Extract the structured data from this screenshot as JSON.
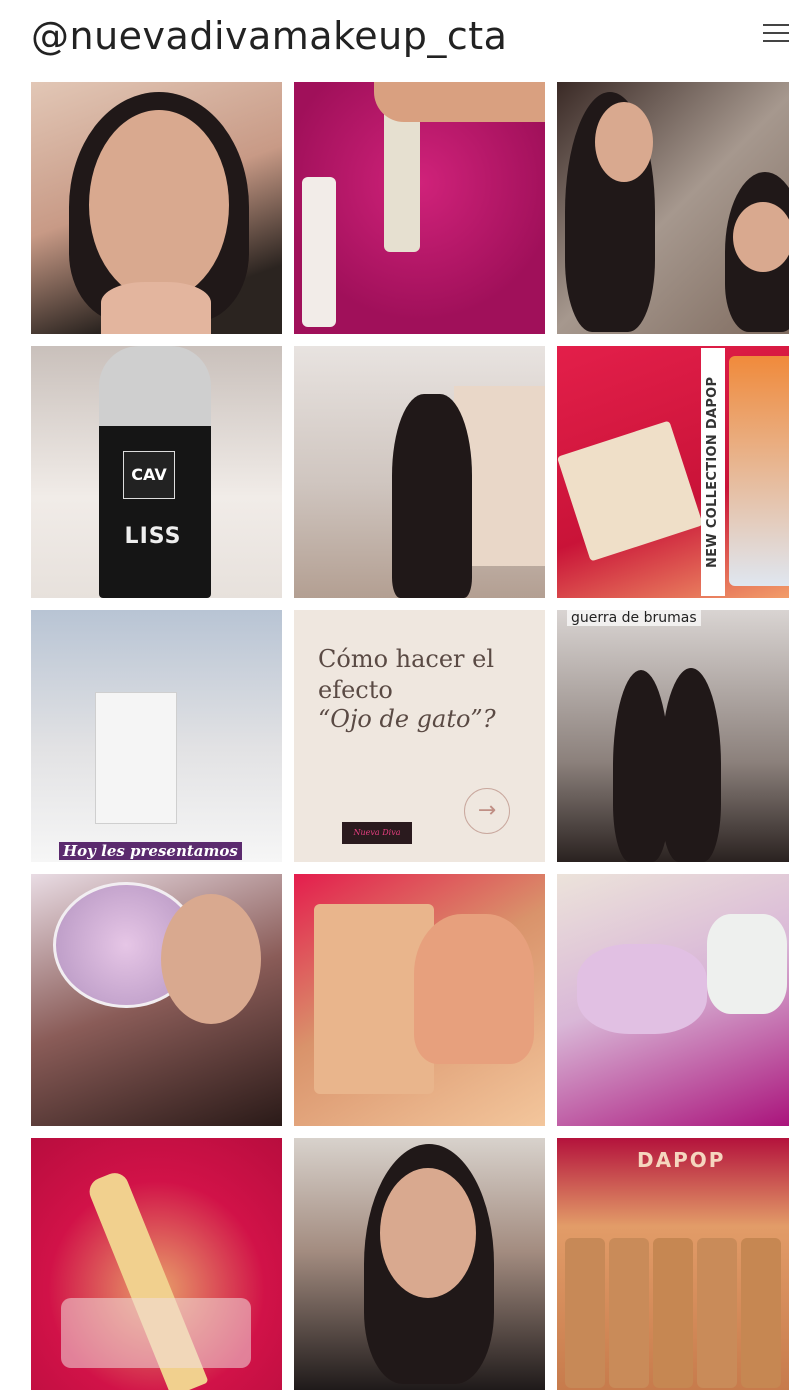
{
  "profile": {
    "handle": "@nuevadivamakeup_cta",
    "menu_icon": "hamburger-menu-icon"
  },
  "tiles": [
    {
      "id": 1,
      "kind": "photo",
      "subject": "woman applying lip product"
    },
    {
      "id": 2,
      "kind": "photo",
      "subject": "spray bottles on pink background"
    },
    {
      "id": 3,
      "kind": "photo",
      "subject": "two women in store"
    },
    {
      "id": 4,
      "kind": "photo",
      "subject": "CAV Max Liss bottle",
      "label_top": "CAV",
      "label_big": "LISS"
    },
    {
      "id": 5,
      "kind": "photo",
      "subject": "woman walking in store aisle"
    },
    {
      "id": 6,
      "kind": "photo",
      "subject": "eyeshadow palette",
      "vertical_text": "NEW COLLECTION DAPOP"
    },
    {
      "id": 7,
      "kind": "photo",
      "subject": "skincare box on counter",
      "caption": "Hoy les presentamos"
    },
    {
      "id": 8,
      "kind": "text",
      "title_line1": "Cómo hacer el efecto",
      "title_line2": "“Ojo de gato”?",
      "arrow_icon": "arrow-right-circle-icon"
    },
    {
      "id": 9,
      "kind": "photo",
      "subject": "two women dancing in store",
      "caption": "guerra de brumas"
    },
    {
      "id": 10,
      "kind": "photo",
      "subject": "woman holding highlighter compact"
    },
    {
      "id": 11,
      "kind": "photo",
      "subject": "concealer display box"
    },
    {
      "id": 12,
      "kind": "photo",
      "subject": "open box with pink towel"
    },
    {
      "id": 13,
      "kind": "photo",
      "subject": "makeup brush on red background"
    },
    {
      "id": 14,
      "kind": "photo",
      "subject": "woman applying product to nose"
    },
    {
      "id": 15,
      "kind": "photo",
      "subject": "DAPOP foundation bottles box",
      "label": "DAPOP"
    }
  ]
}
